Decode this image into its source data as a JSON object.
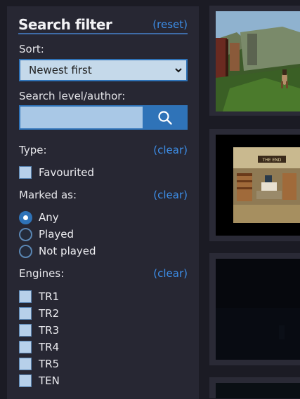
{
  "filter": {
    "title": "Search filter",
    "reset_label": "(reset)",
    "sort": {
      "label": "Sort:",
      "selected": "Newest first"
    },
    "search": {
      "label": "Search level/author:",
      "value": ""
    },
    "type": {
      "label": "Type:",
      "clear_label": "(clear)",
      "options": [
        "Favourited"
      ]
    },
    "marked": {
      "label": "Marked as:",
      "clear_label": "(clear)",
      "options": [
        "Any",
        "Played",
        "Not played"
      ],
      "selected": "Any"
    },
    "engines": {
      "label": "Engines:",
      "clear_label": "(clear)",
      "options": [
        "TR1",
        "TR2",
        "TR3",
        "TR4",
        "TR5",
        "TEN"
      ]
    }
  },
  "results": {
    "cards": [
      {
        "thumb": "screenshot-jungle-level"
      },
      {
        "thumb": "screenshot-library-level",
        "sign_text": "THE END"
      },
      {
        "thumb": "screenshot-dark-level"
      },
      {
        "thumb": "screenshot-partial"
      }
    ]
  },
  "colors": {
    "background": "#1b1b24",
    "panel": "#272733",
    "accent": "#2f73b8",
    "link": "#3d8ee8",
    "input_fill": "#a9c8e6"
  }
}
